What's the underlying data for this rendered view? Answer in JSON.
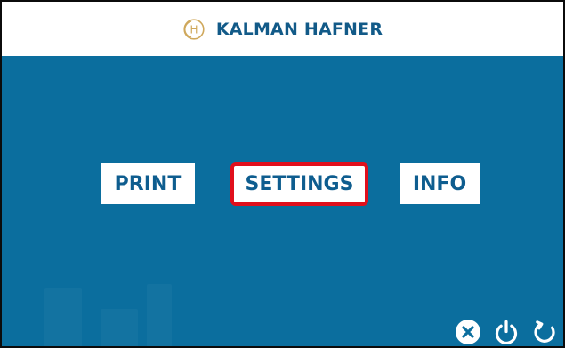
{
  "brand": {
    "name": "KALMAN HAFNER",
    "logo_letter": "H",
    "logo_color": "#cfa85c",
    "text_color": "#125a88"
  },
  "menu": {
    "print": "PRINT",
    "settings": "SETTINGS",
    "info": "INFO"
  },
  "selection": {
    "active_button": "SETTINGS",
    "highlight_color": "#e10f1c"
  },
  "colors": {
    "background": "#0b6e9e",
    "button_background": "#ffffff",
    "button_text": "#0e5d8f"
  },
  "footer": {
    "icons": [
      "close-circle-icon",
      "power-icon",
      "refresh-icon"
    ]
  }
}
